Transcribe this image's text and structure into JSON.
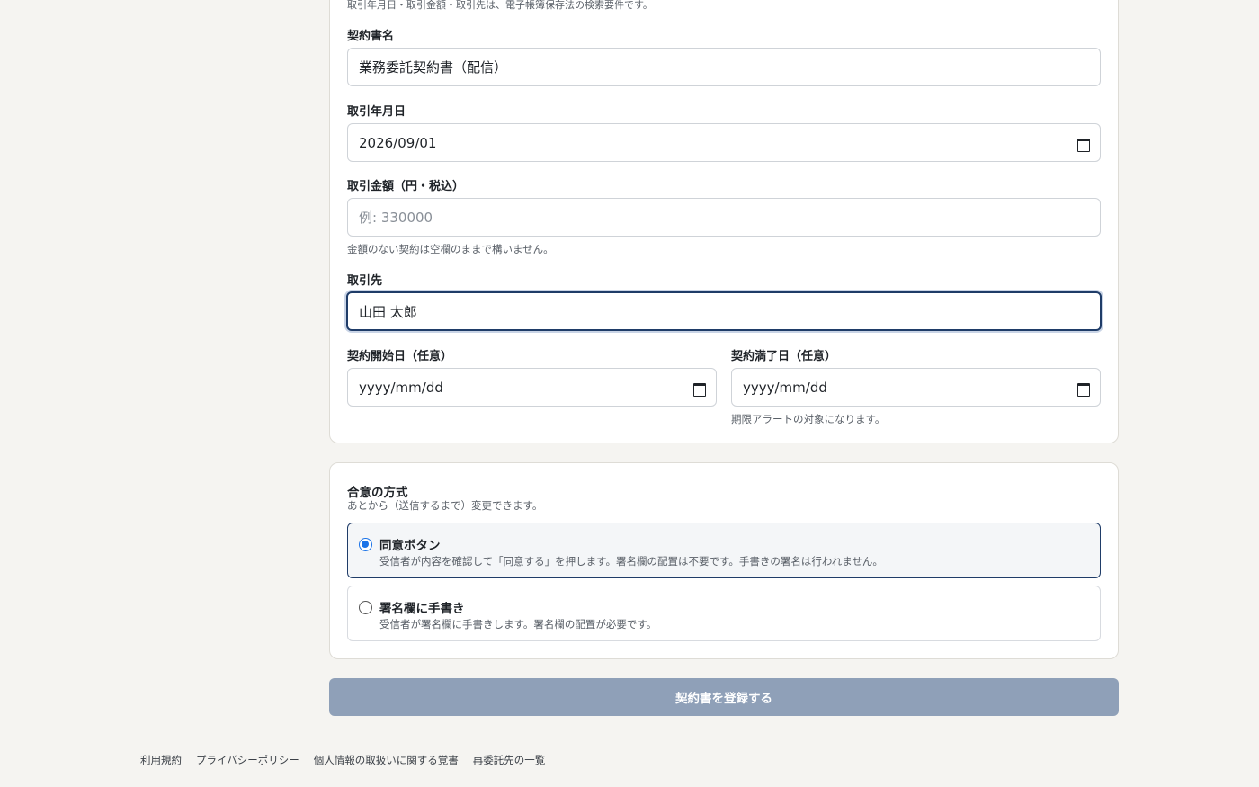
{
  "form": {
    "cutoff_note": "取引年月日・取引金額・取引先は、電子帳簿保存法の検索要件です。",
    "contract_name": {
      "label": "契約書名",
      "value": "業務委託契約書（配信）"
    },
    "transaction_date": {
      "label": "取引年月日",
      "value": "2026/09/01"
    },
    "amount": {
      "label": "取引金額（円・税込）",
      "value": "",
      "placeholder": "例: 330000",
      "hint": "金額のない契約は空欄のままで構いません。"
    },
    "counterparty": {
      "label": "取引先",
      "value": "山田 太郎"
    },
    "start_date": {
      "label": "契約開始日（任意）",
      "value": "yyyy/mm/dd"
    },
    "end_date": {
      "label": "契約満了日（任意）",
      "value": "yyyy/mm/dd",
      "hint": "期限アラートの対象になります。"
    }
  },
  "consent": {
    "title": "合意の方式",
    "subtitle": "あとから（送信するまで）変更できます。",
    "options": [
      {
        "title": "同意ボタン",
        "description": "受信者が内容を確認して「同意する」を押します。署名欄の配置は不要です。手書きの署名は行われません。",
        "selected": true
      },
      {
        "title": "署名欄に手書き",
        "description": "受信者が署名欄に手書きします。署名欄の配置が必要です。",
        "selected": false
      }
    ]
  },
  "submit_label": "契約書を登録する",
  "footer": {
    "links": [
      "利用規約",
      "プライバシーポリシー",
      "個人情報の取扱いに関する覚書",
      "再委託先の一覧"
    ]
  },
  "colors": {
    "accent": "#1f3c68",
    "radio": "#1a73e8",
    "submit_disabled": "#8fa0b8",
    "background": "#f5f4f1"
  },
  "icons": {
    "date_picker": "calendar-icon"
  }
}
